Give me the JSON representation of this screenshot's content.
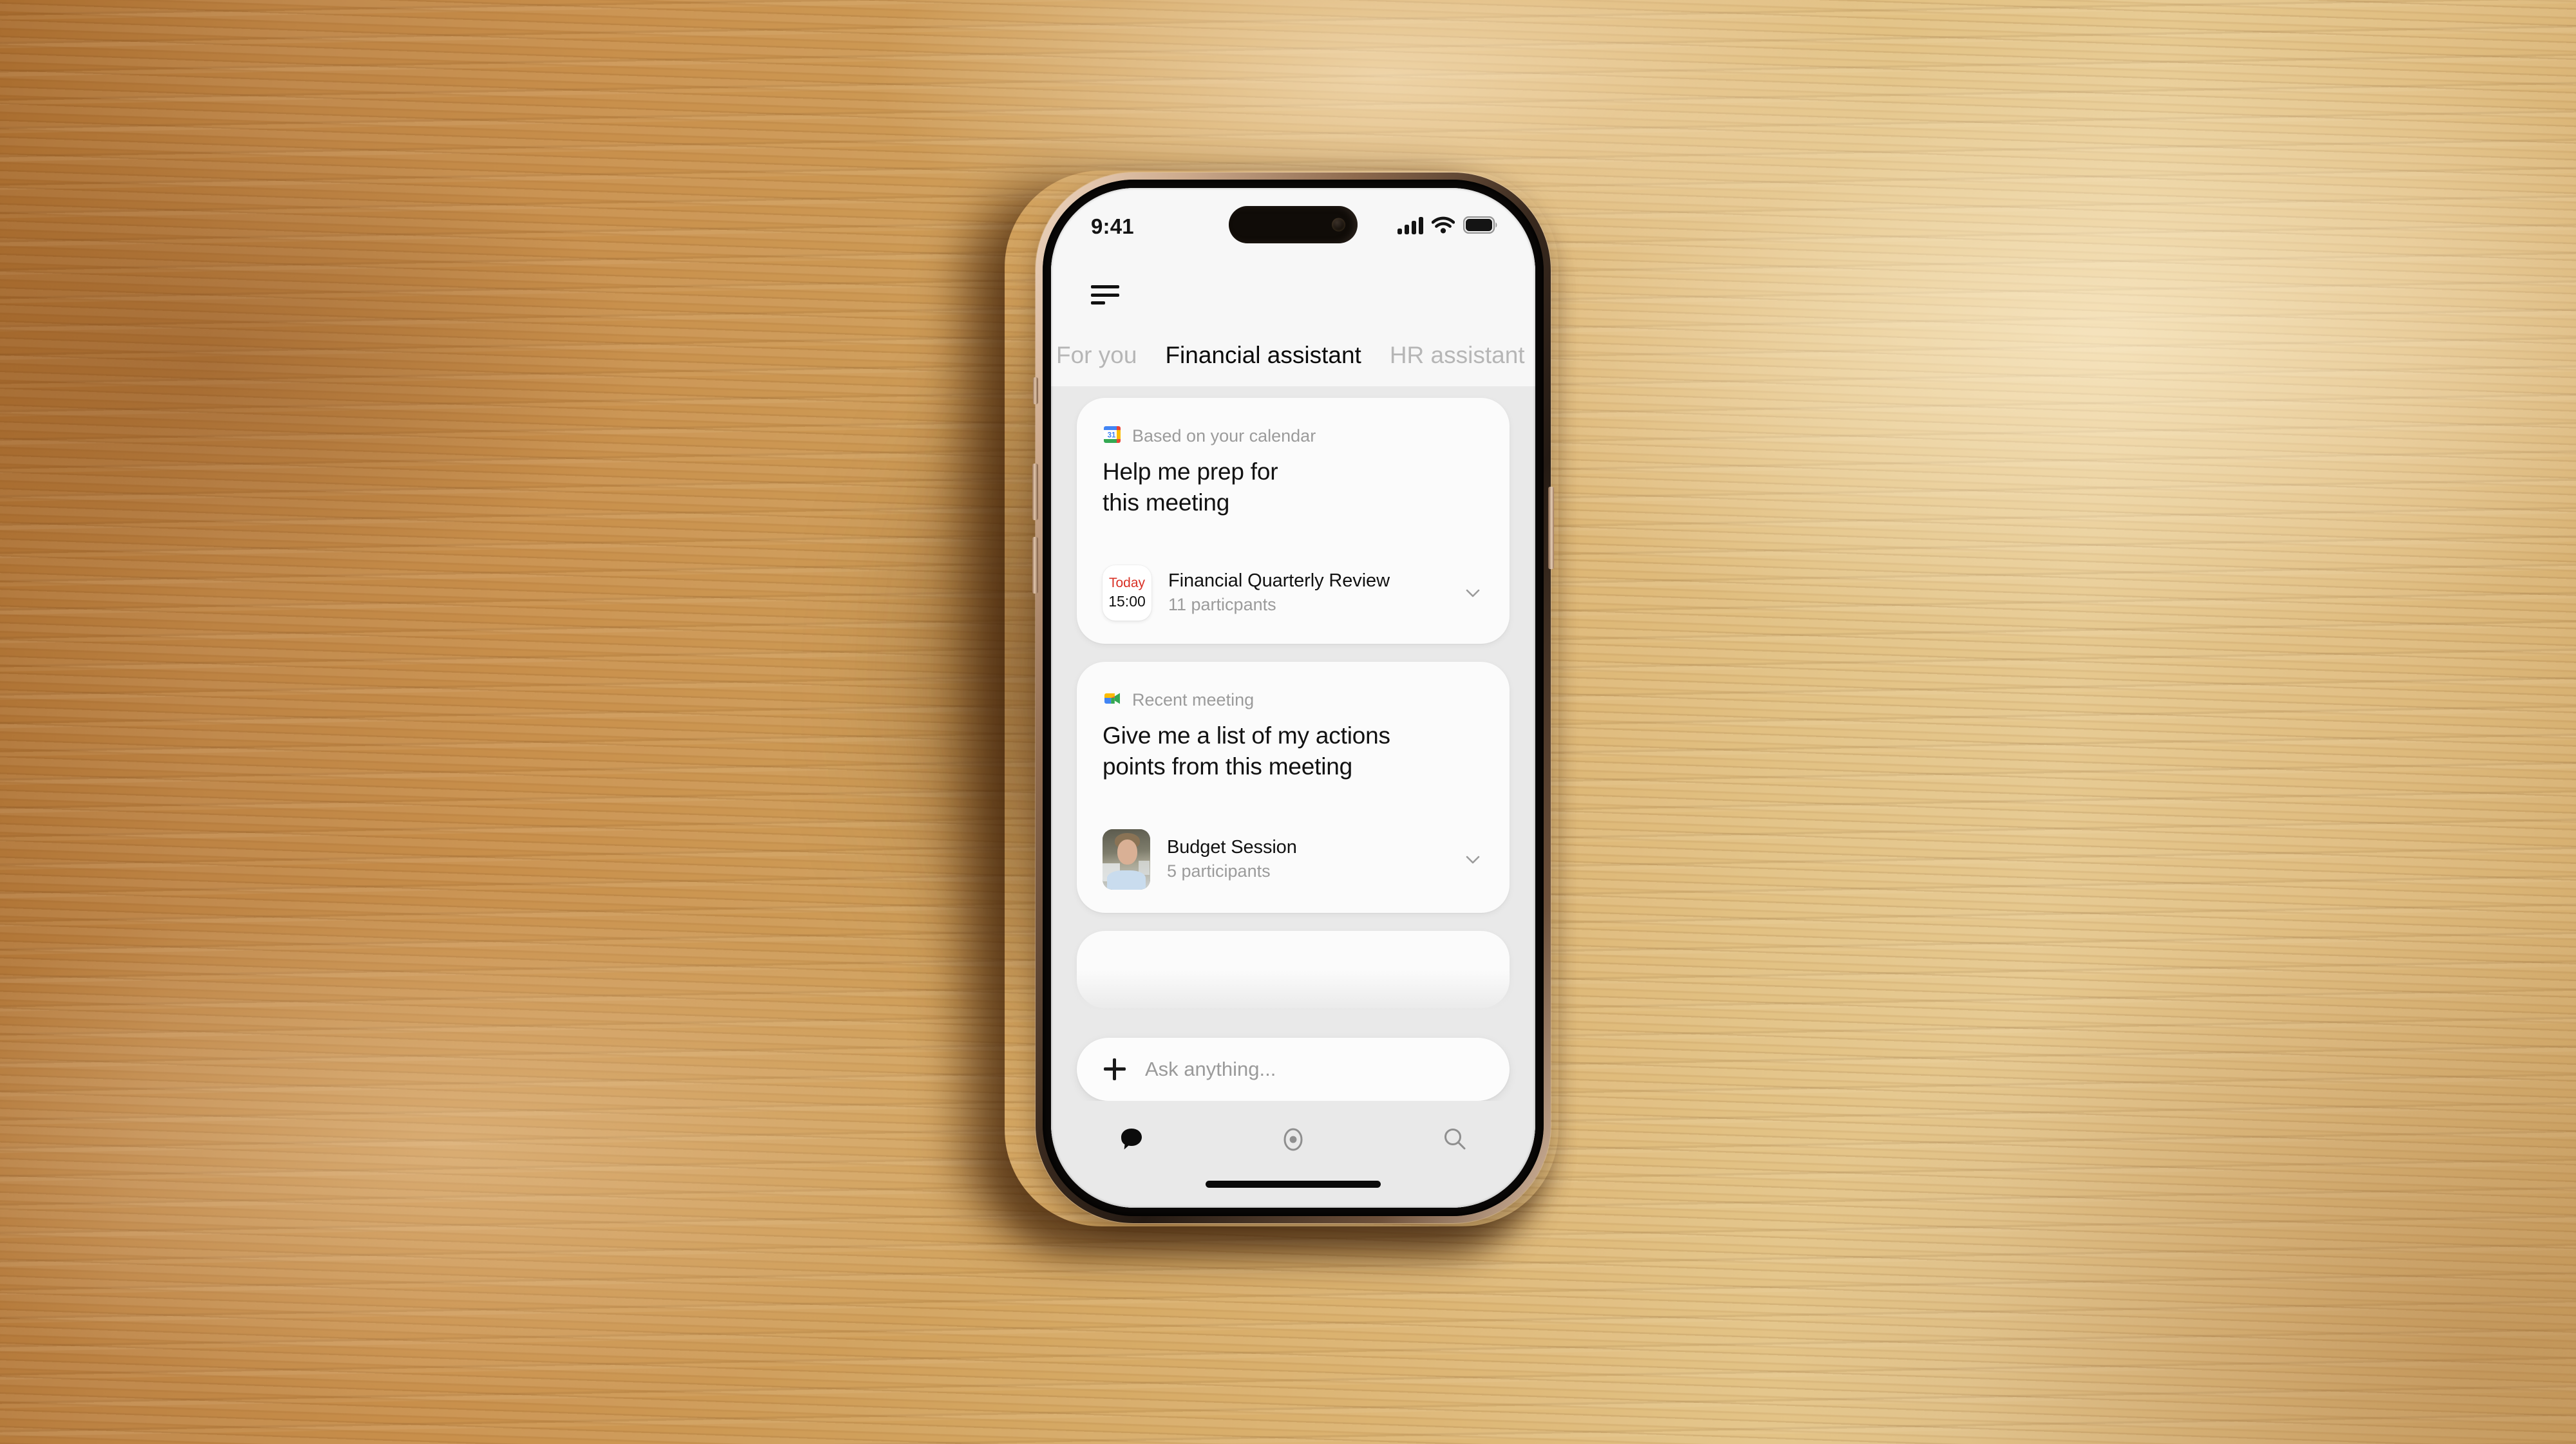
{
  "device": {
    "status_bar": {
      "time": "9:41",
      "icons": [
        "cellular-signal-icon",
        "wifi-icon",
        "battery-icon"
      ],
      "battery_level_pct": 92
    },
    "home_indicator": "home-indicator"
  },
  "colors": {
    "desk_wood_mid": "#cd9954",
    "desk_wood_light": "#e6c88e",
    "desk_wood_dark": "#a96d2f",
    "screen_bg": "#e9e9e9",
    "card_bg": "#fbfbfb",
    "text_primary": "#121212",
    "text_muted": "#9b9b9b",
    "tab_inactive": "#b6b6b6",
    "calendar_red": "#d93025",
    "google_blue": "#4285f4",
    "google_green": "#34a853",
    "google_yellow": "#fbbc04",
    "google_red": "#ea4335"
  },
  "topbar": {
    "menu_icon": "menu-lines-icon"
  },
  "tabs": [
    {
      "id": "for-you",
      "label": "For you",
      "active": false
    },
    {
      "id": "financial-assistant",
      "label": "Financial assistant",
      "active": true
    },
    {
      "id": "hr-assistant",
      "label": "HR assistant",
      "active": false
    }
  ],
  "feed": {
    "cards": [
      {
        "source_icon": "google-calendar-icon",
        "source_label": "Based on your calendar",
        "prompt_line1": "Help me prep for",
        "prompt_line2": "this meeting",
        "attachment": {
          "kind": "calendar-event",
          "date_chip": {
            "day": "Today",
            "time": "15:00"
          },
          "title": "Financial Quarterly Review",
          "subtitle": "11 particpants",
          "expand_icon": "chevron-down-icon"
        }
      },
      {
        "source_icon": "google-meet-icon",
        "source_label": "Recent meeting",
        "prompt_line1": "Give me a list of my actions",
        "prompt_line2": "points from this meeting",
        "attachment": {
          "kind": "meeting-recording",
          "thumbnail": "participant-avatar",
          "title": "Budget Session",
          "subtitle": "5 participants",
          "expand_icon": "chevron-down-icon"
        }
      },
      {
        "source_icon": "",
        "source_label": "",
        "prompt_line1": "",
        "prompt_line2": "",
        "peek": true
      }
    ]
  },
  "composer": {
    "add_icon": "plus-icon",
    "placeholder": "Ask anything...",
    "value": ""
  },
  "bottom_nav": [
    {
      "id": "chat",
      "icon": "chat-bubble-icon",
      "active": true
    },
    {
      "id": "assistant",
      "icon": "record-dot-icon",
      "active": false
    },
    {
      "id": "search",
      "icon": "search-icon",
      "active": false
    }
  ]
}
